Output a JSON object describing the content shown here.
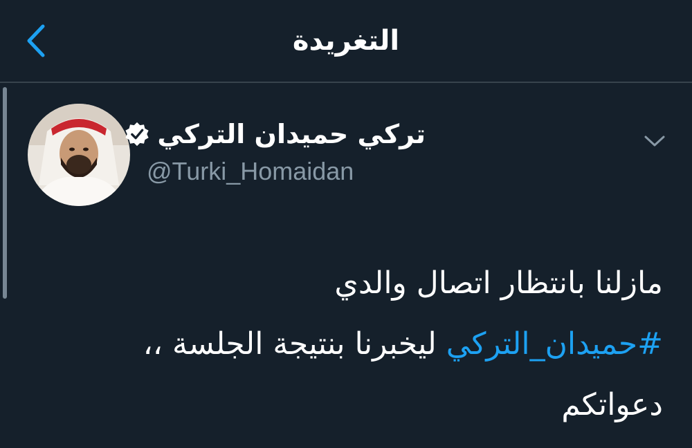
{
  "header": {
    "title": "التغريدة",
    "back_icon": "chevron-left-icon",
    "accent_color": "#1da1f2"
  },
  "tweet": {
    "author": {
      "display_name": "تركي حميدان التركي",
      "handle": "@Turki_Homaidan",
      "verified": true,
      "verified_icon": "verified-badge-icon"
    },
    "more_icon": "chevron-down-icon",
    "text": {
      "line1": "مازلنا بانتظار اتصال والدي",
      "hashtag": "#حميدان_التركي",
      "line2_rest": " ليخبرنا بنتيجة الجلسة ،،",
      "line3": "دعواتكم"
    }
  },
  "colors": {
    "background": "#15202b",
    "secondary_text": "#8899a6",
    "divider": "#38444d"
  }
}
